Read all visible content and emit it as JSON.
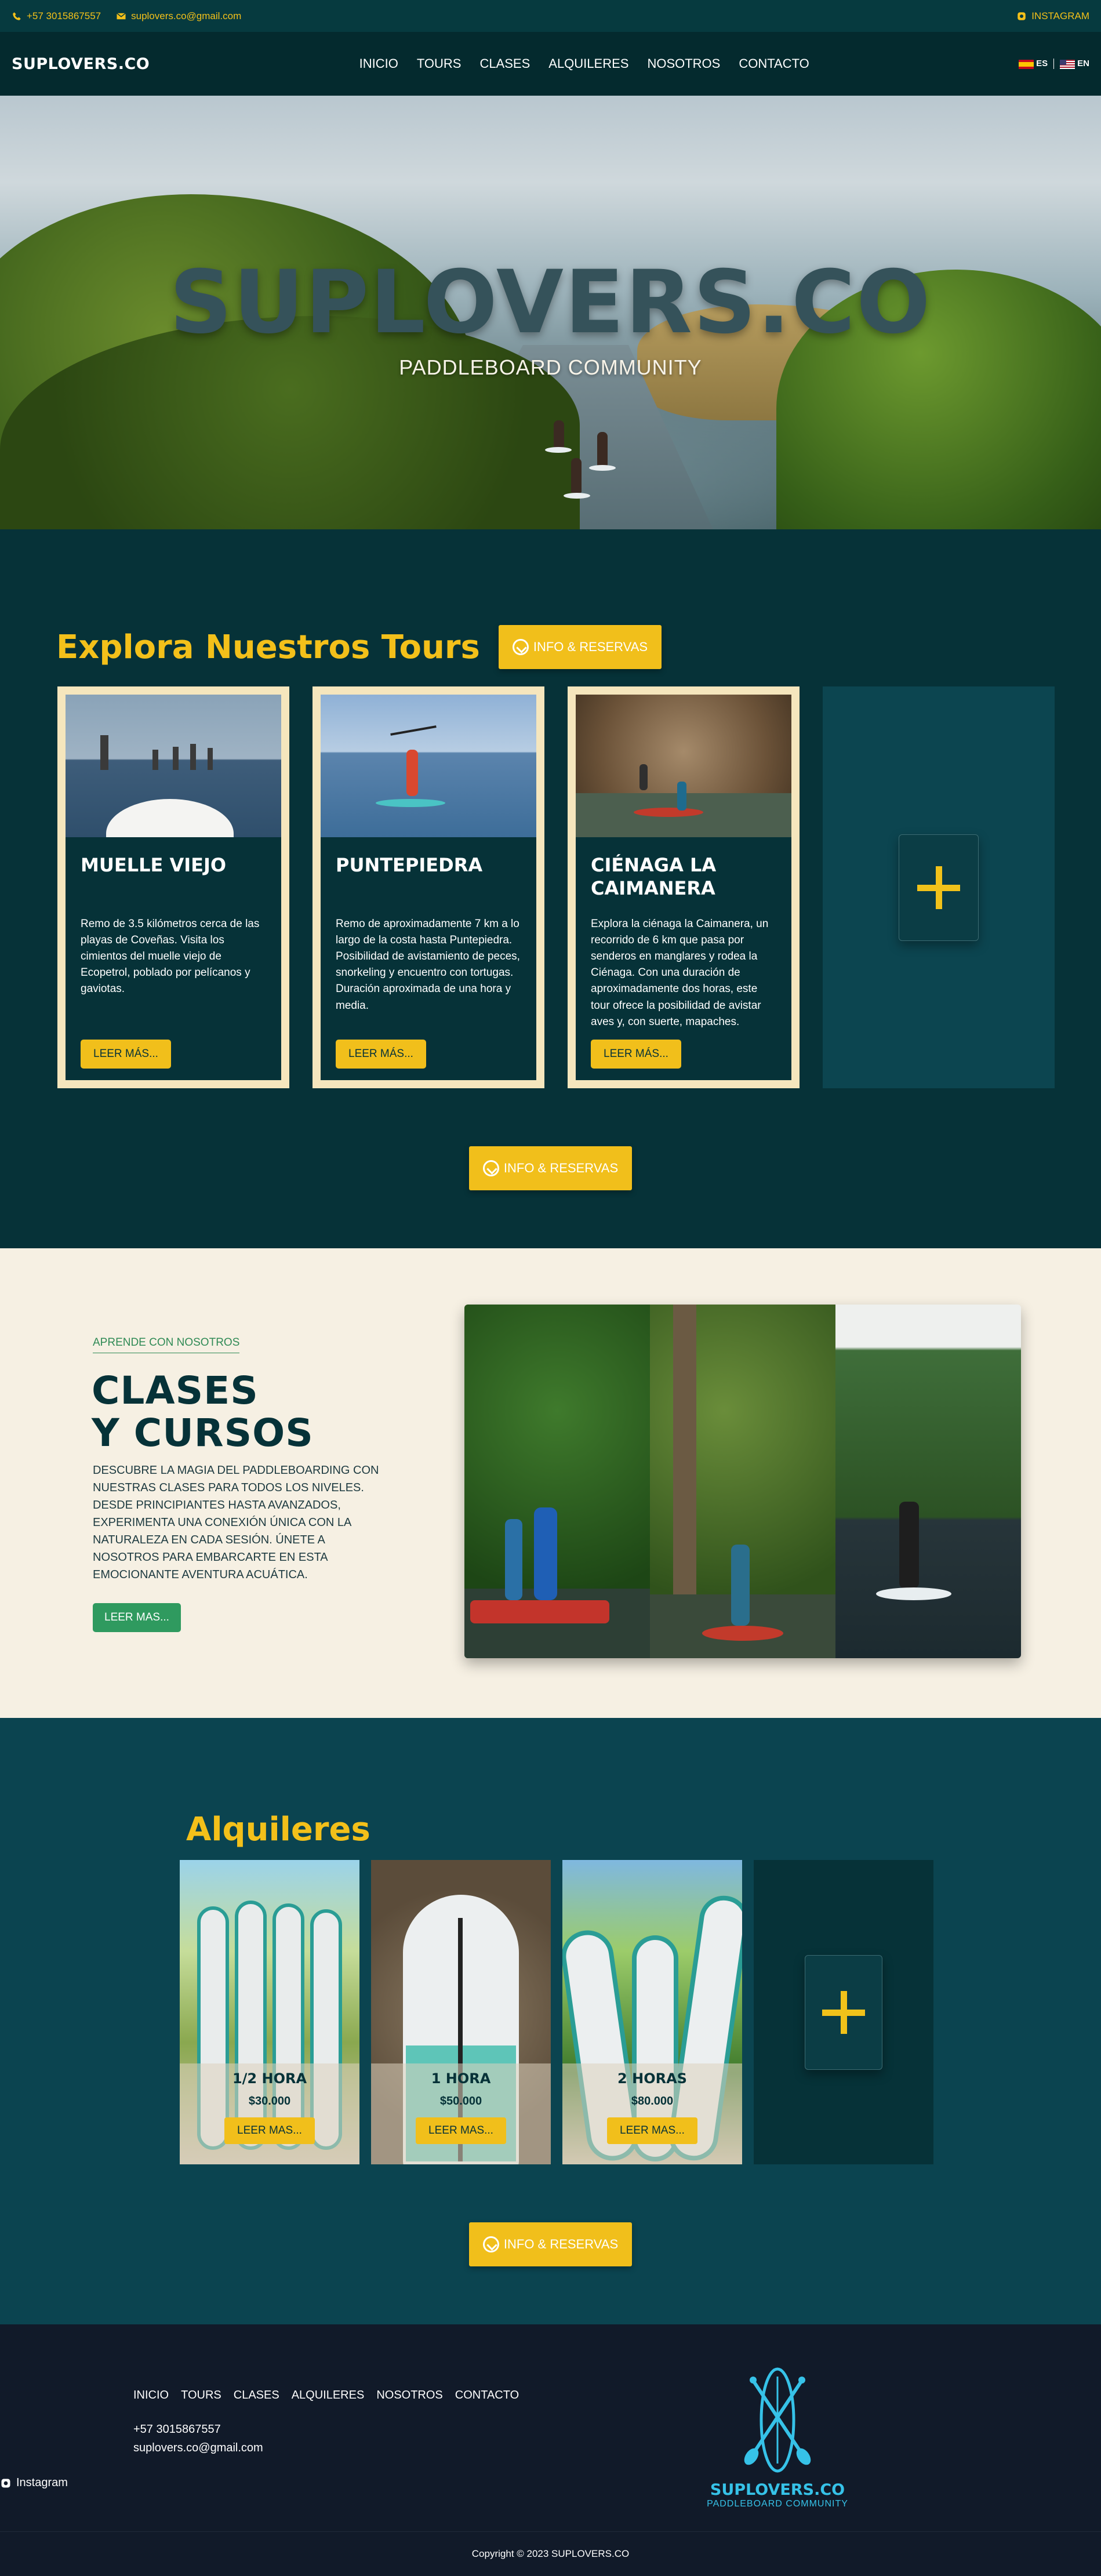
{
  "topbar": {
    "phone": "+57 3015867557",
    "email": "suplovers.co@gmail.com",
    "instagram": "INSTAGRAM"
  },
  "nav": {
    "logo": "SUPLOVERS.CO",
    "items": [
      "INICIO",
      "TOURS",
      "CLASES",
      "ALQUILERES",
      "NOSOTROS",
      "CONTACTO"
    ],
    "lang_es": "ES",
    "lang_en": "EN"
  },
  "hero": {
    "title": "SUPLOVERS.CO",
    "subtitle": "PADDLEBOARD COMMUNITY"
  },
  "tours": {
    "heading": "Explora Nuestros Tours",
    "cta": "INFO & RESERVAS",
    "cards": [
      {
        "title": "MUELLE VIEJO",
        "description": "Remo de 3.5 kilómetros cerca de las playas de Coveñas. Visita los cimientos del muelle viejo de Ecopetrol, poblado por pelícanos y gaviotas.",
        "button": "LEER MÁS..."
      },
      {
        "title": "PUNTEPIEDRA",
        "description": "Remo de aproximadamente 7 km a lo largo de la costa hasta Puntepiedra. Posibilidad de avistamiento de peces, snorkeling y encuentro con tortugas. Duración aproximada de una hora y media.",
        "button": "LEER MÁS..."
      },
      {
        "title": "CIÉNAGA LA CAIMANERA",
        "description": "Explora la ciénaga la Caimanera, un recorrido de 6 km que pasa por senderos en manglares y rodea la Ciénaga. Con una duración de aproximadamente dos horas, este tour ofrece la posibilidad de avistar aves y, con suerte, mapaches.",
        "button": "LEER MÁS..."
      }
    ]
  },
  "clases": {
    "tag": "APRENDE CON NOSOTROS",
    "title_line1": "CLASES",
    "title_line2": "Y CURSOS",
    "description": "DESCUBRE LA MAGIA DEL PADDLEBOARDING CON NUESTRAS CLASES PARA TODOS LOS NIVELES. DESDE PRINCIPIANTES HASTA AVANZADOS, EXPERIMENTA UNA CONEXIÓN ÚNICA CON LA NATURALEZA EN CADA SESIÓN. ÚNETE A NOSOTROS PARA EMBARCARTE EN ESTA EMOCIONANTE AVENTURA ACUÁTICA.",
    "button": "LEER MAS..."
  },
  "alquileres": {
    "heading": "Alquileres",
    "cta": "INFO & RESERVAS",
    "cards": [
      {
        "name": "1/2 HORA",
        "price": "$30.000",
        "button": "LEER MAS..."
      },
      {
        "name": "1 HORA",
        "price": "$50.000",
        "button": "LEER MAS..."
      },
      {
        "name": "2 HORAS",
        "price": "$80.000",
        "button": "LEER MAS..."
      }
    ]
  },
  "footer": {
    "menu": [
      "INICIO",
      "TOURS",
      "CLASES",
      "ALQUILERES",
      "NOSOTROS",
      "CONTACTO"
    ],
    "phone": "+57 3015867557",
    "email": "suplovers.co@gmail.com",
    "instagram": "Instagram",
    "logo_name": "SUPLOVERS.CO",
    "logo_sub": "PADDLEBOARD COMMUNITY",
    "copyright": "Copyright © 2023 SUPLOVERS.CO"
  },
  "colors": {
    "accent_yellow": "#f1bf1b",
    "dark_teal": "#063238",
    "cream": "#f6f0e3",
    "green": "#2f9a5f",
    "logo_cyan": "#36c2e8"
  }
}
